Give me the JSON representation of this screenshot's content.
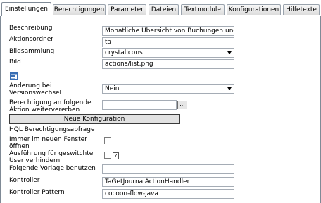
{
  "tabs": [
    {
      "label": "Einstellungen",
      "active": true
    },
    {
      "label": "Berechtigungen"
    },
    {
      "label": "Parameter"
    },
    {
      "label": "Dateien"
    },
    {
      "label": "Textmodule"
    },
    {
      "label": "Konfigurationen"
    },
    {
      "label": "Hilfetexte"
    }
  ],
  "form": {
    "beschreibung": {
      "label": "Beschreibung",
      "value": "Monatliche Übersicht von Buchungen und Z"
    },
    "aktionsordner": {
      "label": "Aktionsordner",
      "value": "ta"
    },
    "bildsammlung": {
      "label": "Bildsammlung",
      "value": "crystalIcons"
    },
    "bild": {
      "label": "Bild",
      "value": "actions/list.png"
    },
    "versionswechsel": {
      "label_line1": "Änderung bei",
      "label_line2": "Versionswechsel",
      "value": "Nein"
    },
    "berechtigung": {
      "label_line1": "Berechtigung an folgende",
      "label_line2": "Aktion weitervererben",
      "value": "",
      "browse_label": "..."
    },
    "new_config_button": "Neue Konfiguration",
    "hql": {
      "label": "HQL Berechtigungsabfrage"
    },
    "neues_fenster": {
      "label_line1": "Immer im neuen Fenster",
      "label_line2": "öffnen",
      "checked": false
    },
    "ausfuehrung": {
      "label_line1": "Ausführung für geswitchte",
      "label_line2": "User verhindern",
      "checked": false,
      "help_label": "?"
    },
    "vorlage": {
      "label": "Folgende Vorlage benutzen",
      "value": ""
    },
    "kontroller": {
      "label": "Kontroller",
      "value": "TaGetJournalActionHandler"
    },
    "kontroller_pattern": {
      "label": "Kontroller Pattern",
      "value": "cocoon-flow-java"
    }
  },
  "colors": {
    "border": "#7f8a96",
    "field_border": "#a5acb5",
    "calendar_icon": "#3a6fb5"
  },
  "icons": {
    "calendar": "calendar-icon",
    "dropdown": "chevron-down-icon"
  }
}
